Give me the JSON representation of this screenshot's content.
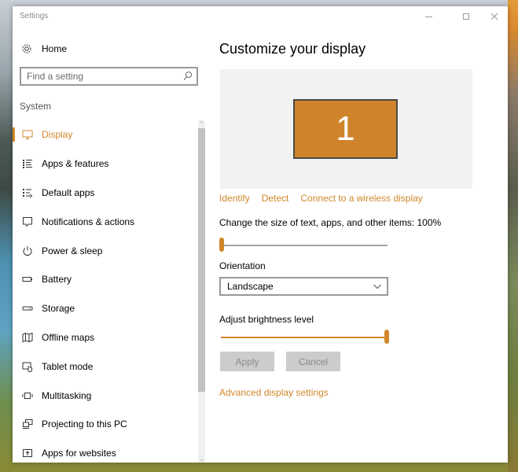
{
  "window": {
    "title": "Settings",
    "controls": {
      "minimize": "minimize",
      "maximize": "maximize",
      "close": "close"
    }
  },
  "sidebar": {
    "home_label": "Home",
    "search_placeholder": "Find a setting",
    "section_label": "System",
    "items": [
      {
        "label": "Display",
        "icon": "monitor-icon",
        "active": true
      },
      {
        "label": "Apps & features",
        "icon": "list-icon",
        "active": false
      },
      {
        "label": "Default apps",
        "icon": "default-apps-icon",
        "active": false
      },
      {
        "label": "Notifications & actions",
        "icon": "notification-icon",
        "active": false
      },
      {
        "label": "Power & sleep",
        "icon": "power-icon",
        "active": false
      },
      {
        "label": "Battery",
        "icon": "battery-icon",
        "active": false
      },
      {
        "label": "Storage",
        "icon": "storage-icon",
        "active": false
      },
      {
        "label": "Offline maps",
        "icon": "map-icon",
        "active": false
      },
      {
        "label": "Tablet mode",
        "icon": "tablet-mode-icon",
        "active": false
      },
      {
        "label": "Multitasking",
        "icon": "multitasking-icon",
        "active": false
      },
      {
        "label": "Projecting to this PC",
        "icon": "projecting-icon",
        "active": false
      },
      {
        "label": "Apps for websites",
        "icon": "apps-websites-icon",
        "active": false
      }
    ]
  },
  "main": {
    "title": "Customize your display",
    "monitor_number": "1",
    "links": [
      "Identify",
      "Detect",
      "Connect to a wireless display"
    ],
    "scale_label": "Change the size of text, apps, and other items: 100%",
    "scale_value_fraction": 0.0,
    "orientation_label": "Orientation",
    "orientation_value": "Landscape",
    "brightness_label": "Adjust brightness level",
    "brightness_value_fraction": 1.0,
    "apply_label": "Apply",
    "cancel_label": "Cancel",
    "advanced_link": "Advanced display settings"
  },
  "colors": {
    "accent": "#d0872b",
    "monitor_fill": "#cf832b",
    "button_disabled": "#cccccc"
  }
}
